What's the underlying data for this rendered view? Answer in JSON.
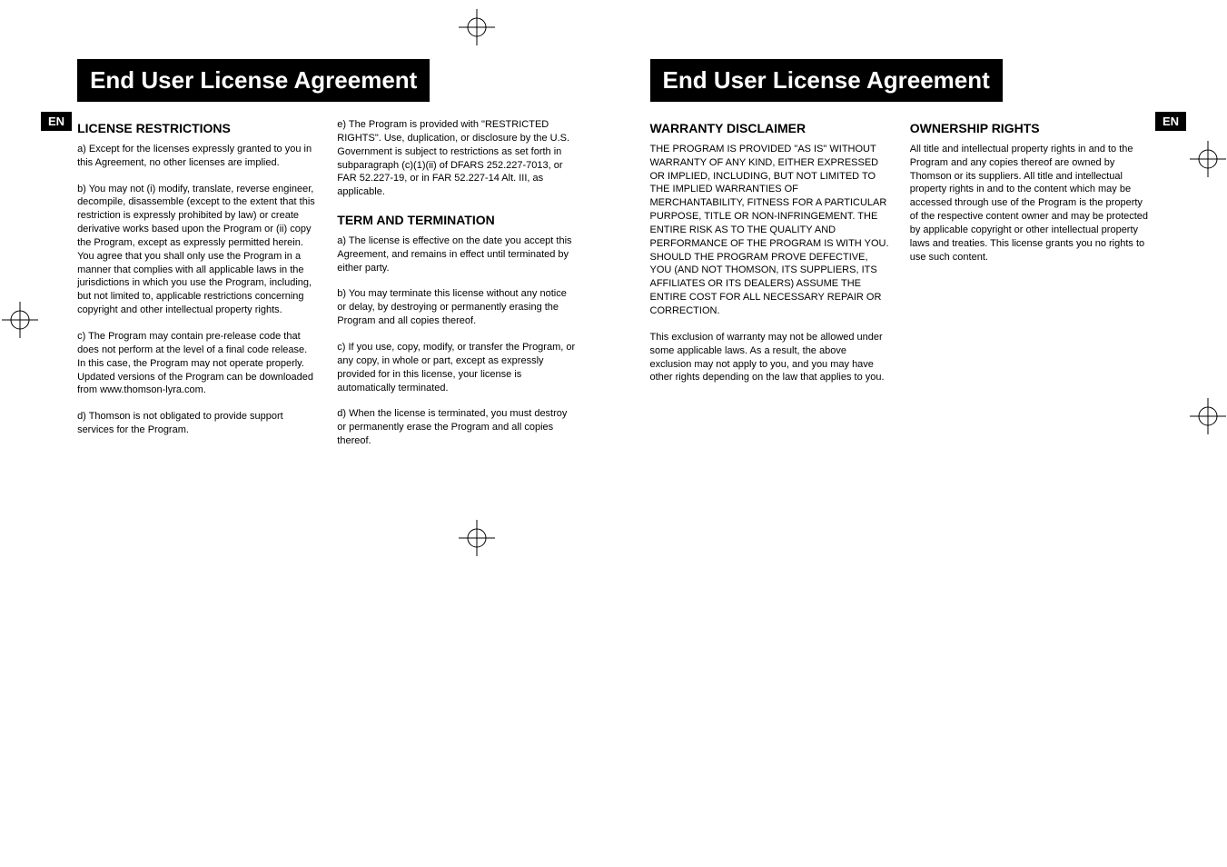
{
  "leftPage": {
    "title": "End User License Agreement",
    "enTag": "EN",
    "col1": {
      "heading1": "LICENSE RESTRICTIONS",
      "pA": "a) Except for the licenses expressly granted to you in this Agreement, no other licenses are implied.",
      "pB": "b) You may not (i) modify, translate, reverse engineer, decompile, disassemble (except to the extent that this restriction is expressly prohibited by law) or create derivative works based upon the Program or (ii) copy the Program, except as expressly permitted herein.  You agree that you shall only use the Program in a manner that complies with all applicable laws in the jurisdictions in which you use the Program, including, but not limited to, applicable restrictions concerning copyright and other intellectual property rights.",
      "pC": "c) The Program may contain pre-release code that does not perform at the level of a final code release.  In this case, the Program may not operate properly.  Updated versions of the Program can be downloaded from www.thomson-lyra.com.",
      "pD": "d) Thomson is not obligated to provide support services for the Program."
    },
    "col2": {
      "pE": "e) The Program is provided with \"RESTRICTED RIGHTS\". Use, duplication, or disclosure by the U.S. Government is subject to restrictions as set forth in subparagraph (c)(1)(ii) of DFARS 252.227-7013, or FAR 52.227-19, or in FAR 52.227-14 Alt. III, as applicable.",
      "heading2": "TERM AND TERMINATION",
      "pA": "a) The license is effective on the date you accept this Agreement, and remains in effect until terminated by either party.",
      "pB": "b) You may terminate this license without any notice or delay, by destroying or permanently erasing the Program and all copies thereof.",
      "pC": "c) If you use, copy, modify, or transfer the Program, or any copy, in whole or part, except as expressly provided for in this license, your license is automatically terminated.",
      "pD": "d) When the license is terminated, you must destroy or permanently erase the Program and all copies thereof."
    }
  },
  "rightPage": {
    "title": "End User License Agreement",
    "enTag": "EN",
    "col1": {
      "heading1": "WARRANTY DISCLAIMER",
      "p1": "THE PROGRAM IS PROVIDED \"AS IS\" WITHOUT WARRANTY OF ANY KIND, EITHER EXPRESSED OR IMPLIED, INCLUDING, BUT NOT LIMITED TO THE IMPLIED WARRANTIES OF MERCHANTABILITY, FITNESS FOR A PARTICULAR PURPOSE, TITLE OR NON-INFRINGEMENT.  THE ENTIRE RISK AS TO THE QUALITY AND PERFORMANCE OF THE PROGRAM IS WITH YOU.  SHOULD THE PROGRAM PROVE DEFECTIVE, YOU (AND NOT THOMSON, ITS SUPPLIERS, ITS AFFILIATES OR ITS DEALERS) ASSUME THE ENTIRE COST FOR ALL NECESSARY REPAIR OR CORRECTION.",
      "p2": "This exclusion of warranty may not be allowed under some applicable laws. As a result, the above exclusion may not apply to you, and you may have other rights depending on the law that applies to you."
    },
    "col2": {
      "heading2": "OWNERSHIP RIGHTS",
      "p1": "All title and intellectual property rights in and to the Program and any copies thereof are owned by Thomson or its suppliers.  All title and intellectual property rights in and to the content which may be accessed through use of the Program is the property of the respective content owner and may be protected by applicable copyright or other intellectual property laws and treaties. This license grants you no rights to use such content."
    }
  }
}
